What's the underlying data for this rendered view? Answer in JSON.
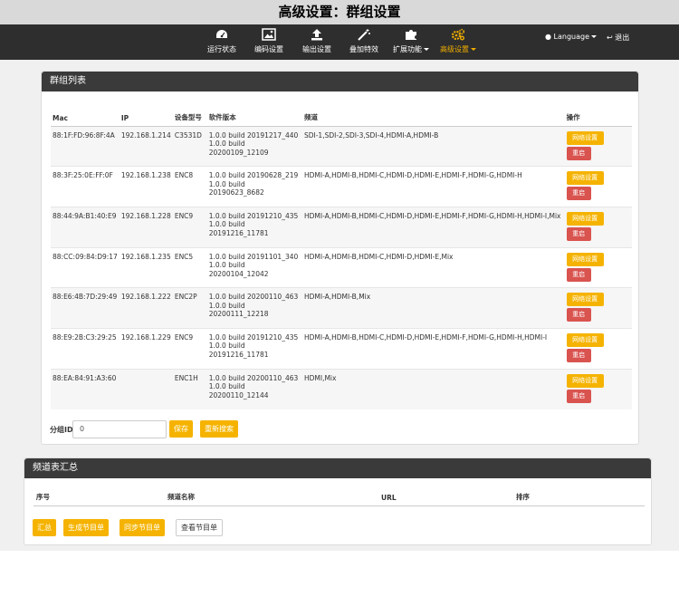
{
  "caption": "高级设置：群组设置",
  "nav": {
    "items": [
      {
        "label": "运行状态",
        "icon": "dashboard-icon"
      },
      {
        "label": "编码设置",
        "icon": "image-icon"
      },
      {
        "label": "输出设置",
        "icon": "upload-icon"
      },
      {
        "label": "叠加特效",
        "icon": "magic-wand-icon"
      },
      {
        "label": "扩展功能",
        "icon": "puzzle-icon"
      },
      {
        "label": "高级设置",
        "icon": "gears-icon"
      }
    ],
    "language": "Language",
    "logout": "退出",
    "active_color": "#f0ad00"
  },
  "group_panel": {
    "title": "群组列表",
    "headers": {
      "mac": "Mac",
      "ip": "IP",
      "model": "设备型号",
      "firmware": "软件版本",
      "channels": "频道",
      "actions": "操作"
    },
    "rows": [
      {
        "mac": "88:1F:FD:96:8F:4A",
        "ip": "192.168.1.214",
        "model": "C3531D",
        "fw1": "1.0.0 build 20191217_440",
        "fw2": "1.0.0 build",
        "fw3": "20200109_12109",
        "channels": "SDI-1,SDI-2,SDI-3,SDI-4,HDMI-A,HDMI-B"
      },
      {
        "mac": "88:3F:25:0E:FF:0F",
        "ip": "192.168.1.238",
        "model": "ENC8",
        "fw1": "1.0.0 build 20190628_219",
        "fw2": "1.0.0 build 20190623_8682",
        "fw3": "",
        "channels": "HDMI-A,HDMI-B,HDMI-C,HDMI-D,HDMI-E,HDMI-F,HDMI-G,HDMI-H"
      },
      {
        "mac": "88:44:9A:B1:40:E9",
        "ip": "192.168.1.228",
        "model": "ENC9",
        "fw1": "1.0.0 build 20191210_435",
        "fw2": "1.0.0 build",
        "fw3": "20191216_11781",
        "channels": "HDMI-A,HDMI-B,HDMI-C,HDMI-D,HDMI-E,HDMI-F,HDMI-G,HDMI-H,HDMI-I,Mix"
      },
      {
        "mac": "88:CC:09:84:D9:17",
        "ip": "192.168.1.235",
        "model": "ENC5",
        "fw1": "1.0.0 build 20191101_340",
        "fw2": "1.0.0 build",
        "fw3": "20200104_12042",
        "channels": "HDMI-A,HDMI-B,HDMI-C,HDMI-D,HDMI-E,Mix"
      },
      {
        "mac": "88:E6:4B:7D:29:49",
        "ip": "192.168.1.222",
        "model": "ENC2P",
        "fw1": "1.0.0 build 20200110_463",
        "fw2": "1.0.0 build",
        "fw3": "20200111_12218",
        "channels": "HDMI-A,HDMI-B,Mix"
      },
      {
        "mac": "88:E9:2B:C3:29:25",
        "ip": "192.168.1.229",
        "model": "ENC9",
        "fw1": "1.0.0 build 20191210_435",
        "fw2": "1.0.0 build",
        "fw3": "20191216_11781",
        "channels": "HDMI-A,HDMI-B,HDMI-C,HDMI-D,HDMI-E,HDMI-F,HDMI-G,HDMI-H,HDMI-I"
      },
      {
        "mac": "88:EA:84:91:A3:60",
        "ip": "",
        "model": "ENC1H",
        "fw1": "1.0.0 build 20200110_463",
        "fw2": "1.0.0 build",
        "fw3": "20200110_12144",
        "channels": "HDMI,Mix"
      }
    ],
    "net_button": "网络设置",
    "reboot_button": "重启",
    "group_id_label": "分组ID",
    "group_id_placeholder": "0",
    "save_button": "保存",
    "rescan_button": "重新搜索"
  },
  "channel_panel": {
    "title": "频道表汇总",
    "headers": {
      "index": "序号",
      "name": "频道名称",
      "url": "URL",
      "sort": "排序"
    },
    "buttons": {
      "summary": "汇总",
      "generate": "生成节目单",
      "sync": "同步节目单",
      "view": "查看节目单"
    }
  },
  "colors": {
    "yellow": "#f5b300",
    "red": "#d9534f",
    "dark": "#2e2e2e"
  }
}
